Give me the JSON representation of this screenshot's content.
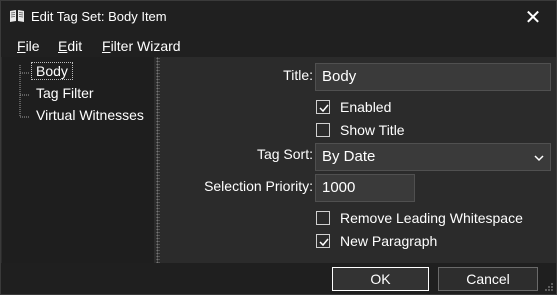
{
  "window": {
    "title": "Edit Tag Set: Body Item",
    "close_glyph": "✕",
    "app_icon": "book-icon"
  },
  "menu": {
    "file": {
      "first": "F",
      "rest": "ile"
    },
    "edit": {
      "first": "E",
      "rest": "dit"
    },
    "filter_wizard": {
      "first": "F",
      "rest": "ilter Wizard"
    }
  },
  "tree": {
    "items": [
      "Body",
      "Tag Filter",
      "Virtual Witnesses"
    ],
    "selected": "Body"
  },
  "form": {
    "title_label": "Title:",
    "title_value": "Body",
    "enabled_label": "Enabled",
    "enabled_checked": true,
    "show_title_label": "Show Title",
    "show_title_checked": false,
    "tag_sort_label": "Tag Sort:",
    "tag_sort_value": "By Date",
    "selection_priority_label": "Selection Priority:",
    "selection_priority_value": "1000",
    "remove_ws_label": "Remove Leading Whitespace",
    "remove_ws_checked": false,
    "new_paragraph_label": "New Paragraph",
    "new_paragraph_checked": true
  },
  "buttons": {
    "ok": "OK",
    "cancel": "Cancel"
  },
  "colors": {
    "window_bg": "#2b2b2b",
    "titlebar_bg": "#202020",
    "tree_bg": "#1e1e1e",
    "input_bg": "#3a3a3a",
    "text": "#ffffff"
  }
}
